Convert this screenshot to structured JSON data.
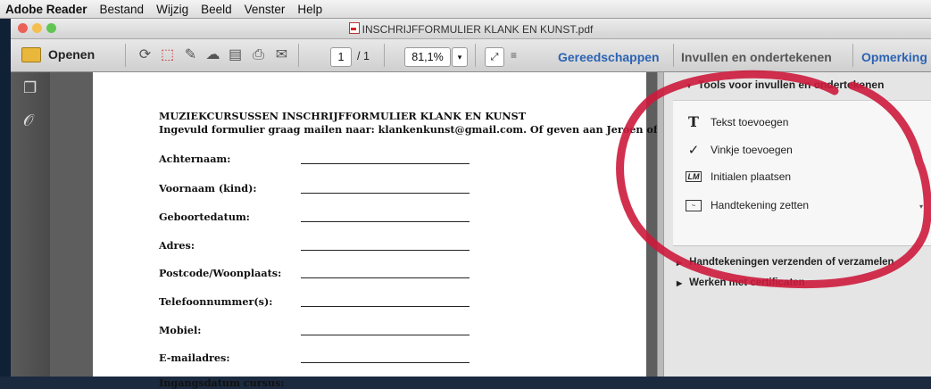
{
  "menubar": {
    "app_name": "Adobe Reader",
    "items": [
      "Bestand",
      "Wijzig",
      "Beeld",
      "Venster",
      "Help"
    ]
  },
  "window": {
    "title": "INSCHRIJFFORMULIER KLANK EN KUNST.pdf",
    "traffic_light_colors": [
      "#ec5f57",
      "#f4bf4f",
      "#61c554"
    ]
  },
  "toolbar": {
    "open_label": "Openen",
    "page_current": "1",
    "page_total": "/ 1",
    "zoom": "81,1%",
    "links": [
      "Gereedschappen",
      "Invullen en ondertekenen",
      "Opmerking"
    ],
    "link_colors": [
      "#2b63b4",
      "#555555",
      "#2b63b4"
    ]
  },
  "document": {
    "title": "MUZIEKCURSUSSEN INSCHRIJFFORMULIER KLANK EN KUNST",
    "subtitle": "Ingevuld formulier graag mailen naar: klankenkunst@gmail.com.  Of geven aan Jeroen of Femke.",
    "fields": [
      "Achternaam:",
      "Voornaam (kind):",
      "Geboortedatum:",
      "Adres:",
      "Postcode/Woonplaats:",
      "Telefoonnummer(s):",
      "Mobiel:",
      "E-mailadres:",
      "Ingangsdatum cursus:"
    ]
  },
  "panel": {
    "section_title": "Tools voor invullen en ondertekenen",
    "tools": [
      {
        "icon": "text-icon",
        "label": "Tekst toevoegen"
      },
      {
        "icon": "checkmark-icon",
        "label": "Vinkje toevoegen"
      },
      {
        "icon": "initials-icon",
        "label": "Initialen plaatsen"
      },
      {
        "icon": "signature-icon",
        "label": "Handtekening zetten"
      }
    ],
    "collapsed_sections": [
      "Handtekeningen verzenden of verzamelen",
      "Werken met certificaten"
    ]
  },
  "annotation": {
    "circle_color": "#cc1b3c"
  }
}
